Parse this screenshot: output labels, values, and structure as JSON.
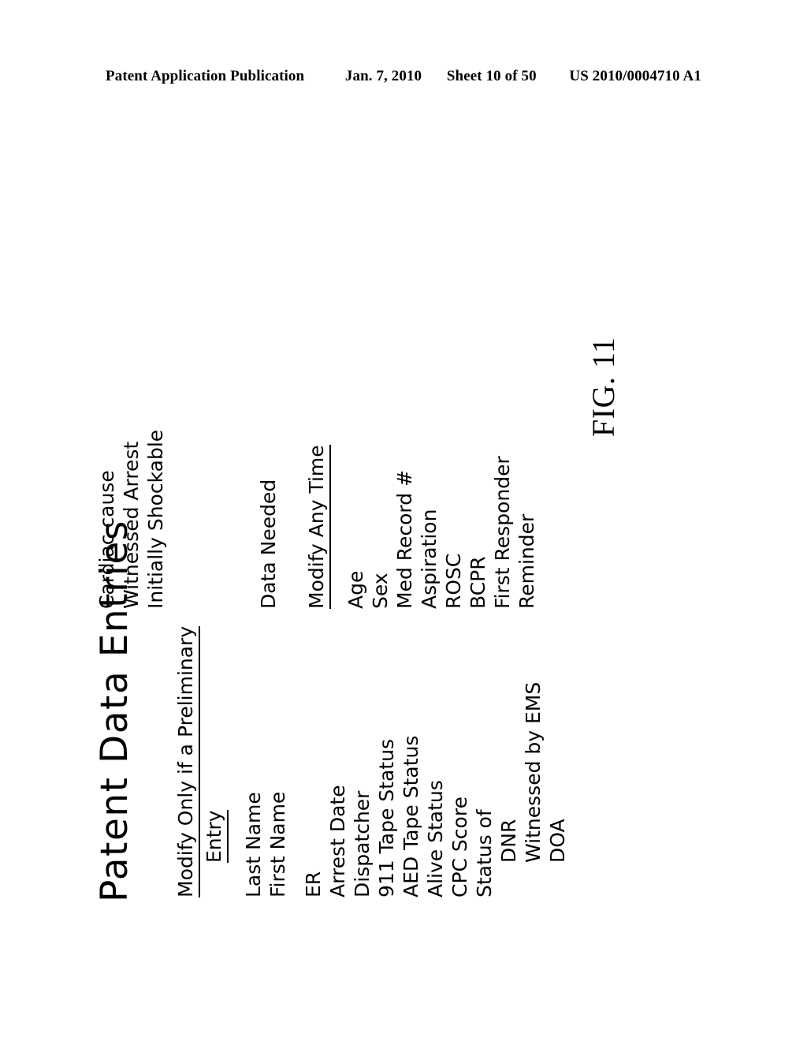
{
  "patent_header": {
    "publication": "Patent Application Publication",
    "date": "Jan. 7, 2010",
    "sheet": "Sheet 10 of 50",
    "doc_number": "US 2010/0004710 A1"
  },
  "figure": {
    "title": "Patent Data Entries",
    "label": "FIG. 11",
    "left_column": {
      "heading_line_1": "Modify Only if a Preliminary",
      "heading_line_2": "Entry",
      "items": [
        "Last Name",
        "First Name",
        "ER",
        "Arrest Date",
        "Dispatcher",
        "911 Tape Status",
        "AED Tape Status",
        "Alive Status",
        "CPC Score",
        "Status of"
      ],
      "sub_items": [
        "DNR",
        "Witnessed by EMS",
        "DOA"
      ]
    },
    "right_column": {
      "top_items": [
        "Cardiac cause",
        "Witnessed Arrest",
        "Initially Shockable"
      ],
      "section_label": "Data Needed",
      "heading": "Modify Any Time",
      "items": [
        "Age",
        "Sex",
        "Med Record #",
        "Aspiration",
        "ROSC",
        "BCPR",
        "First Responder",
        "Reminder"
      ]
    }
  }
}
